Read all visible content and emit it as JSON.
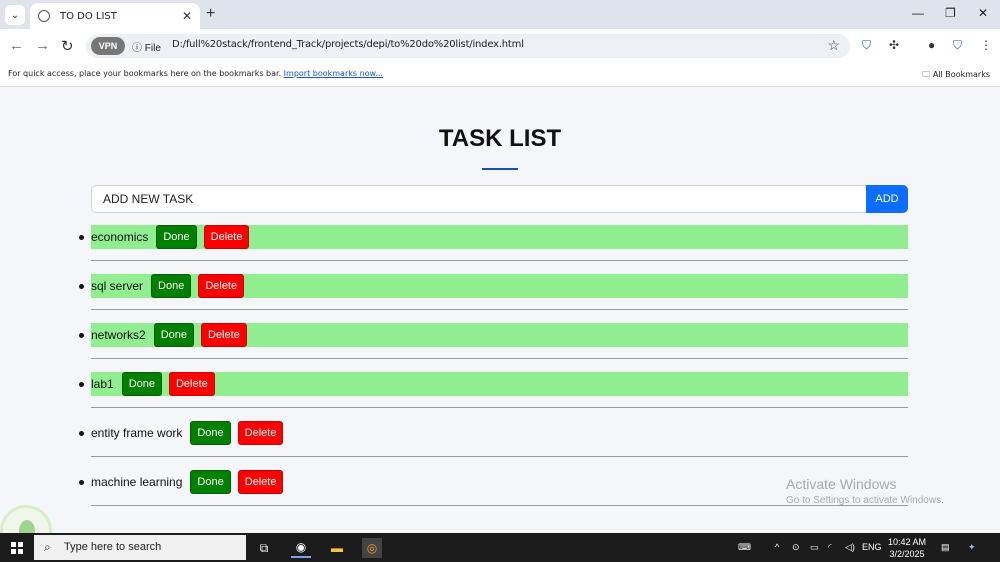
{
  "browser": {
    "tab_title": "TO DO LIST",
    "new_tab_symbol": "+",
    "close_symbol": "✕",
    "vpn_label": "VPN",
    "file_label": "File",
    "url": "D:/full%20stack/frontend_Track/projects/depi/to%20do%20list/index.html",
    "bookmarks_message": "For quick access, place your bookmarks here on the bookmarks bar.",
    "import_link": "Import bookmarks now...",
    "all_bookmarks": "All Bookmarks"
  },
  "page": {
    "heading": "TASK LIST",
    "input_placeholder": "ADD NEW TASK",
    "add_button": "ADD",
    "done_label": "Done",
    "delete_label": "Delete",
    "done_highlight_color": "#90ee90",
    "done_button_color": "#008000",
    "delete_button_color": "#ff0000",
    "add_button_color": "#0d6efd",
    "tasks": [
      {
        "name": "economics",
        "done": true
      },
      {
        "name": "sql server",
        "done": true
      },
      {
        "name": "networks2",
        "done": true
      },
      {
        "name": "lab1",
        "done": true
      },
      {
        "name": "entity frame work",
        "done": false
      },
      {
        "name": "machine learning",
        "done": false
      }
    ]
  },
  "watermark": {
    "line1": "Activate Windows",
    "line2": "Go to Settings to activate Windows."
  },
  "taskbar": {
    "search_text": "Type here to search",
    "language": "ENG",
    "time": "10:42 AM",
    "date": "3/2/2025"
  }
}
